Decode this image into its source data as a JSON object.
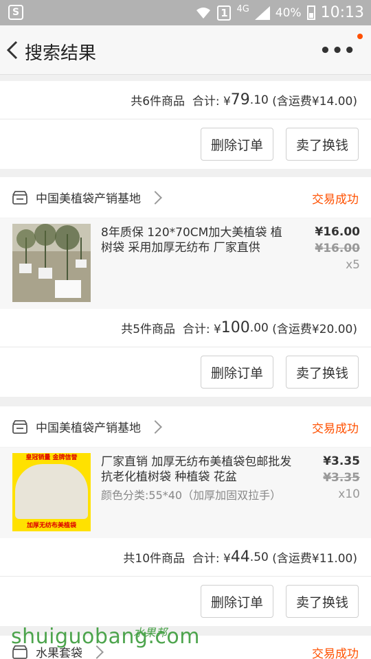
{
  "status_bar": {
    "signal_label": "4G",
    "sim_slot": "1",
    "battery": "40%",
    "time": "10:13"
  },
  "header": {
    "title": "搜索结果"
  },
  "order_top": {
    "count_label": "共6件商品",
    "total_label": "合计: ¥",
    "total_int": "79",
    "total_dec": ".10",
    "shipping": "(含运费¥14.00)",
    "delete_label": "删除订单",
    "resell_label": "卖了换钱"
  },
  "order_1": {
    "shop_name": "中国美植袋产销基地",
    "status": "交易成功",
    "product_title": "8年质保 120*70CM加大美植袋 植树袋 采用加厚无纺布 厂家直供",
    "price": "¥16.00",
    "old_price": "¥16.00",
    "qty": "x5",
    "count_label": "共5件商品",
    "total_label": "合计: ¥",
    "total_int": "100",
    "total_dec": ".00",
    "shipping": "(含运费¥20.00)",
    "delete_label": "删除订单",
    "resell_label": "卖了换钱"
  },
  "order_2": {
    "shop_name": "中国美植袋产销基地",
    "status": "交易成功",
    "product_title": "厂家直销 加厚无纺布美植袋包邮批发 抗老化植树袋 种植袋 花盆",
    "sku": "颜色分类:55*40（加厚加固双拉手）",
    "thumb_top": "皇冠销量 金牌信誉",
    "thumb_bottom": "加厚无纺布美植袋",
    "price": "¥3.35",
    "old_price": "¥3.35",
    "qty": "x10",
    "count_label": "共10件商品",
    "total_label": "合计: ¥",
    "total_int": "44",
    "total_dec": ".50",
    "shipping": "(含运费¥11.00)",
    "delete_label": "删除订单",
    "resell_label": "卖了换钱"
  },
  "order_3": {
    "shop_name": "水果套袋",
    "status": "交易成功"
  },
  "watermark": {
    "text": "shuiguobang.com",
    "sub": "水果邦"
  }
}
